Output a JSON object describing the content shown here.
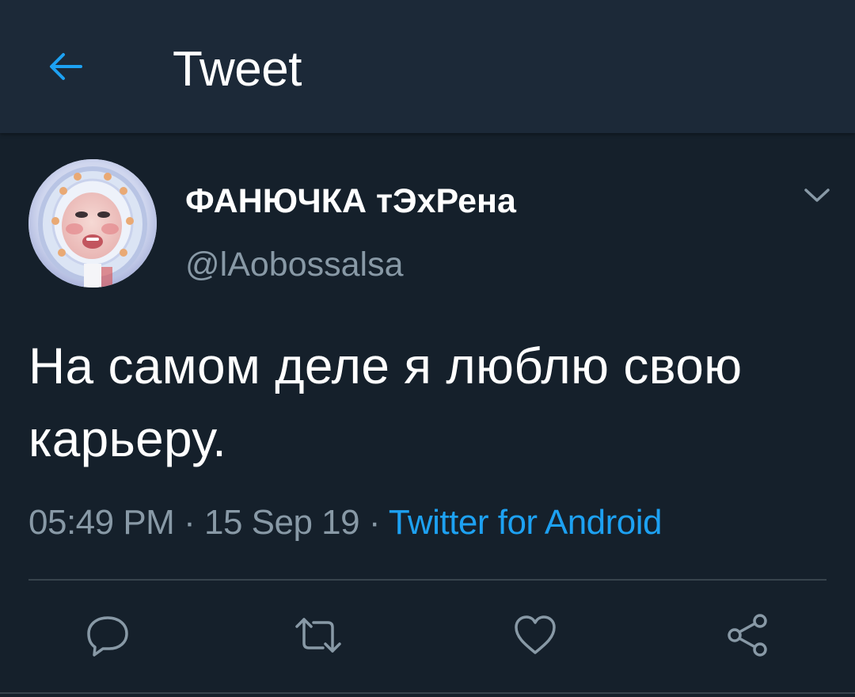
{
  "header": {
    "title": "Tweet",
    "back_icon": "arrow-left-icon"
  },
  "author": {
    "display_name": "ФАНЮЧКА тЭхРена",
    "handle": "@lAobossalsa",
    "avatar_icon": "avatar-photo"
  },
  "tweet": {
    "text": "На самом деле я люблю свою карьеру.",
    "time": "05:49 PM",
    "separator": "·",
    "date": "15 Sep 19",
    "source": "Twitter for Android"
  },
  "actions": [
    {
      "name": "reply",
      "icon": "reply-icon"
    },
    {
      "name": "retweet",
      "icon": "retweet-icon"
    },
    {
      "name": "like",
      "icon": "heart-icon"
    },
    {
      "name": "share",
      "icon": "share-icon"
    }
  ],
  "colors": {
    "background": "#15202b",
    "header": "#1c2938",
    "accent": "#1da1f2",
    "secondary_text": "#8899a6",
    "divider": "#38444d"
  }
}
